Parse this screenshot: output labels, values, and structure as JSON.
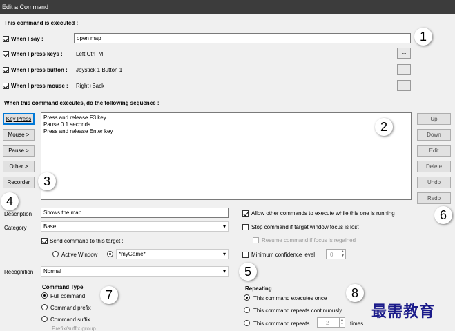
{
  "window": {
    "title": "Edit a Command"
  },
  "executed_section": {
    "heading": "This command is executed :",
    "say": {
      "label": "When I say :",
      "value": "open map",
      "checked": true
    },
    "keys": {
      "label": "When I press keys :",
      "value": "Left Ctrl+M",
      "checked": true,
      "button": "..."
    },
    "joystick": {
      "label": "When I press button :",
      "value": "Joystick 1 Button 1",
      "checked": true,
      "button": "..."
    },
    "mouse": {
      "label": "When I press mouse :",
      "value": "Right+Back",
      "checked": true,
      "button": "..."
    }
  },
  "sequence_section": {
    "heading": "When this command executes, do the following sequence :",
    "items": [
      "Press and release F3 key",
      "Pause 0.1 seconds",
      "Press and release Enter key"
    ],
    "left_buttons": [
      "Key Press",
      "Mouse >",
      "Pause >",
      "Other >",
      "Recorder"
    ],
    "right_buttons": [
      "Up",
      "Down",
      "Edit",
      "Delete",
      "Undo",
      "Redo"
    ]
  },
  "description": {
    "label": "Description",
    "value": "Shows the map"
  },
  "category": {
    "label": "Category",
    "value": "Base"
  },
  "target": {
    "checkbox_label": "Send command to this target :",
    "checked": true,
    "active_window_label": "Active Window",
    "game_value": "*myGame*"
  },
  "recognition": {
    "label": "Recognition",
    "value": "Normal"
  },
  "options": {
    "allow_other": {
      "label": "Allow other commands to execute while this one is running",
      "checked": true
    },
    "stop_focus": {
      "label": "Stop command if target window focus is lost",
      "checked": false
    },
    "resume_focus": {
      "label": "Resume command if focus is regained",
      "checked": false
    },
    "min_conf": {
      "label": "Minimum confidence level",
      "checked": false,
      "value": "0"
    }
  },
  "command_type": {
    "heading": "Command Type",
    "options": [
      "Full command",
      "Command prefix",
      "Command suffix"
    ],
    "selected": 0,
    "group_label": "Prefix/suffix group"
  },
  "repeating": {
    "heading": "Repeating",
    "once": "This command executes once",
    "continuous": "This command repeats continuously",
    "repeats_label": "This command repeats",
    "repeats_value": "2",
    "times_label": "times"
  },
  "annotations": [
    "1",
    "2",
    "3",
    "4",
    "5",
    "6",
    "7",
    "8"
  ],
  "watermark": "最需教育",
  "colors": {
    "titlebar": "#3c3c3c",
    "focus_blue": "#0078d7",
    "watermark": "#1b1b8a"
  }
}
